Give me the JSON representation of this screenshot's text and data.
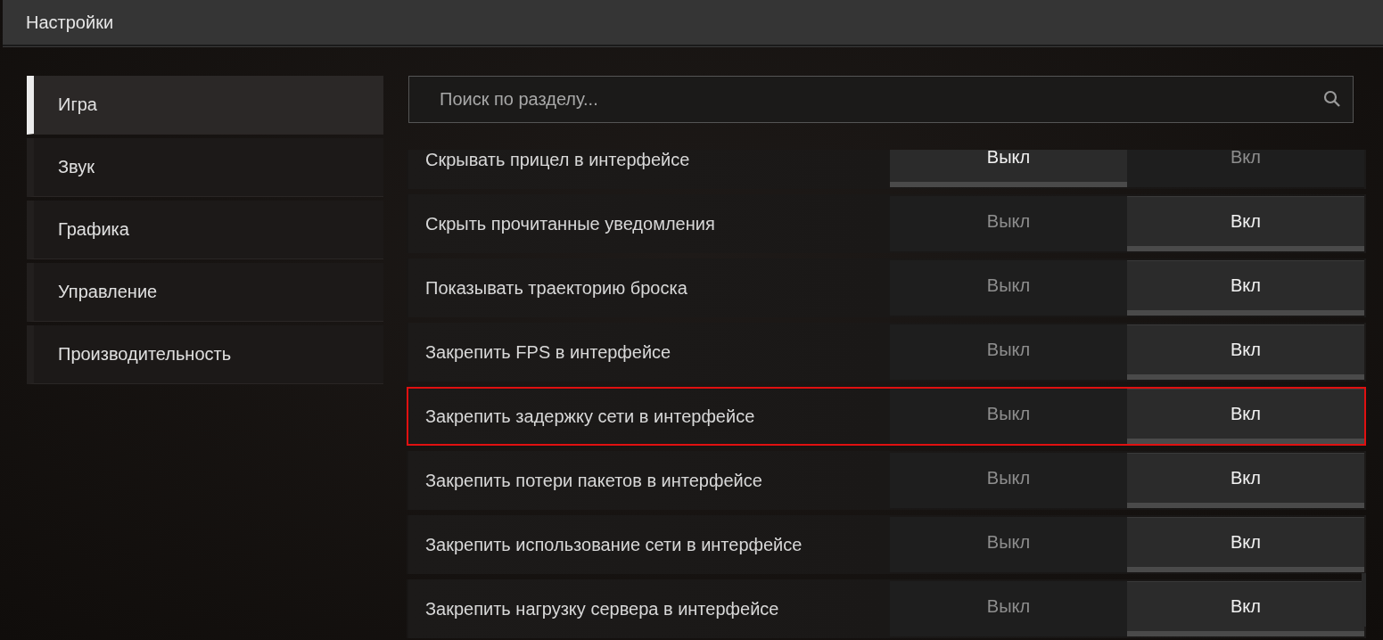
{
  "window": {
    "title": "Настройки"
  },
  "sidebar": {
    "items": [
      {
        "label": "Игра",
        "selected": true
      },
      {
        "label": "Звук",
        "selected": false
      },
      {
        "label": "Графика",
        "selected": false
      },
      {
        "label": "Управление",
        "selected": false
      },
      {
        "label": "Производительность",
        "selected": false
      }
    ]
  },
  "search": {
    "placeholder": "Поиск по разделу..."
  },
  "settings": [
    {
      "label": "Скрывать прицел в интерфейсе",
      "highlighted": false,
      "options": [
        {
          "label": "Выкл",
          "selected": true
        },
        {
          "label": "Вкл",
          "selected": false
        }
      ]
    },
    {
      "label": "Скрыть прочитанные уведомления",
      "highlighted": false,
      "options": [
        {
          "label": "Выкл",
          "selected": false
        },
        {
          "label": "Вкл",
          "selected": true
        }
      ]
    },
    {
      "label": "Показывать траекторию броска",
      "highlighted": false,
      "options": [
        {
          "label": "Выкл",
          "selected": false
        },
        {
          "label": "Вкл",
          "selected": true
        }
      ]
    },
    {
      "label": "Закрепить FPS в интерфейсе",
      "highlighted": false,
      "options": [
        {
          "label": "Выкл",
          "selected": false
        },
        {
          "label": "Вкл",
          "selected": true
        }
      ]
    },
    {
      "label": "Закрепить задержку сети в интерфейсе",
      "highlighted": true,
      "options": [
        {
          "label": "Выкл",
          "selected": false
        },
        {
          "label": "Вкл",
          "selected": true
        }
      ]
    },
    {
      "label": "Закрепить потери пакетов в интерфейсе",
      "highlighted": false,
      "options": [
        {
          "label": "Выкл",
          "selected": false
        },
        {
          "label": "Вкл",
          "selected": true
        }
      ]
    },
    {
      "label": "Закрепить использование сети в интерфейсе",
      "highlighted": false,
      "options": [
        {
          "label": "Выкл",
          "selected": false
        },
        {
          "label": "Вкл",
          "selected": true
        }
      ]
    },
    {
      "label": "Закрепить нагрузку сервера в интерфейсе",
      "highlighted": false,
      "options": [
        {
          "label": "Выкл",
          "selected": false
        },
        {
          "label": "Вкл",
          "selected": true
        }
      ]
    }
  ]
}
